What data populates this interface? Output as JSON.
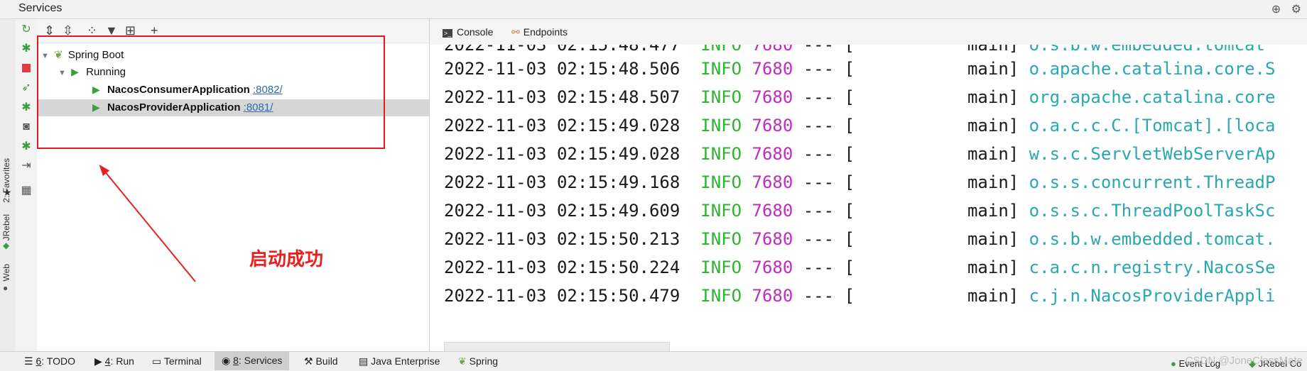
{
  "window": {
    "title": "Services"
  },
  "left_stripe": {
    "favorites": "2: Favorites",
    "jrebel": "JRebel",
    "web": "Web"
  },
  "tree": {
    "root": "Spring Boot",
    "group": "Running",
    "apps": [
      {
        "name": "NacosConsumerApplication",
        "port": ":8082/"
      },
      {
        "name": "NacosProviderApplication",
        "port": ":8081/"
      }
    ]
  },
  "annotation": "启动成功",
  "console_tabs": [
    "Console",
    "Endpoints"
  ],
  "log_lines": [
    {
      "ts": "2022-11-03 02:15:48.506",
      "level": "INFO",
      "pid": "7680",
      "sep": "---",
      "bracket": "[",
      "thread": "main]",
      "logger": "o.apache.catalina.core.S"
    },
    {
      "ts": "2022-11-03 02:15:48.507",
      "level": "INFO",
      "pid": "7680",
      "sep": "---",
      "bracket": "[",
      "thread": "main]",
      "logger": "org.apache.catalina.core"
    },
    {
      "ts": "2022-11-03 02:15:49.028",
      "level": "INFO",
      "pid": "7680",
      "sep": "---",
      "bracket": "[",
      "thread": "main]",
      "logger": "o.a.c.c.C.[Tomcat].[loca"
    },
    {
      "ts": "2022-11-03 02:15:49.028",
      "level": "INFO",
      "pid": "7680",
      "sep": "---",
      "bracket": "[",
      "thread": "main]",
      "logger": "w.s.c.ServletWebServerAp"
    },
    {
      "ts": "2022-11-03 02:15:49.168",
      "level": "INFO",
      "pid": "7680",
      "sep": "---",
      "bracket": "[",
      "thread": "main]",
      "logger": "o.s.s.concurrent.ThreadP"
    },
    {
      "ts": "2022-11-03 02:15:49.609",
      "level": "INFO",
      "pid": "7680",
      "sep": "---",
      "bracket": "[",
      "thread": "main]",
      "logger": "o.s.s.c.ThreadPoolTaskSc"
    },
    {
      "ts": "2022-11-03 02:15:50.213",
      "level": "INFO",
      "pid": "7680",
      "sep": "---",
      "bracket": "[",
      "thread": "main]",
      "logger": "o.s.b.w.embedded.tomcat."
    },
    {
      "ts": "2022-11-03 02:15:50.224",
      "level": "INFO",
      "pid": "7680",
      "sep": "---",
      "bracket": "[",
      "thread": "main]",
      "logger": "c.a.c.n.registry.NacosSe"
    },
    {
      "ts": "2022-11-03 02:15:50.479",
      "level": "INFO",
      "pid": "7680",
      "sep": "---",
      "bracket": "[",
      "thread": "main]",
      "logger": "c.j.n.NacosProviderAppli"
    }
  ],
  "bottom_tabs": [
    {
      "num": "6",
      "label": ": TODO"
    },
    {
      "num": "4",
      "label": ": Run"
    },
    {
      "num": "",
      "label": "Terminal"
    },
    {
      "num": "8",
      "label": ": Services"
    },
    {
      "num": "",
      "label": "Build"
    },
    {
      "num": "",
      "label": "Java Enterprise"
    },
    {
      "num": "",
      "label": "Spring"
    }
  ],
  "status_right": {
    "event_log": "Event Log",
    "jrebel": "JRebel Co"
  },
  "watermark": "CSDN @JoneClassMate",
  "colors": {
    "info": "#2cb52c",
    "pid": "#c02cc0",
    "logger": "#2aa8b0",
    "annotation": "#e52222",
    "run_green": "#3c9e3c"
  },
  "icons": [
    "rerun-icon",
    "debug-icon",
    "stop-icon",
    "run-config-icon",
    "camera-icon",
    "login-icon",
    "layout-icon",
    "expand-all-icon",
    "collapse-all-icon",
    "group-icon",
    "filter-icon",
    "new-tab-icon",
    "add-icon",
    "globe-icon",
    "gear-icon",
    "console-icon",
    "endpoints-icon",
    "star-icon"
  ]
}
